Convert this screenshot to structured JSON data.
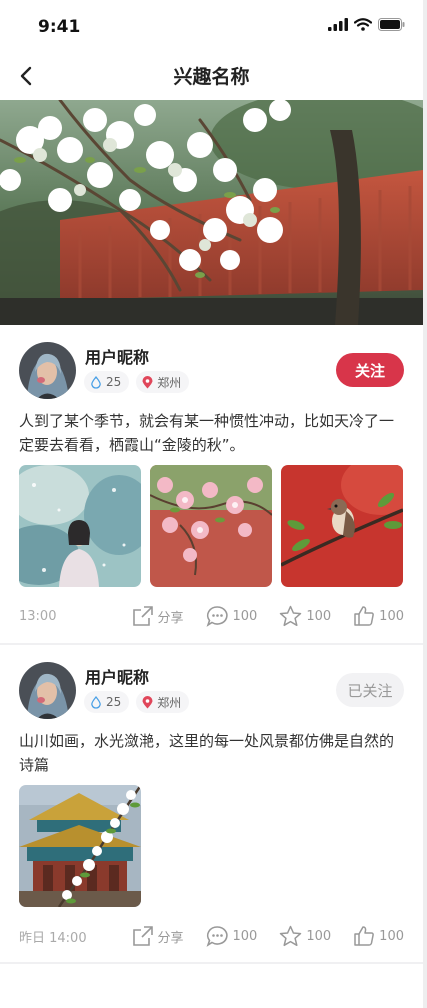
{
  "status_bar": {
    "time": "9:41"
  },
  "nav": {
    "title": "兴趣名称"
  },
  "posts": [
    {
      "nickname": "用户昵称",
      "level": "25",
      "location": "郑州",
      "follow_label": "关注",
      "text": "人到了某个季节，就会有某一种惯性冲动，比如天冷了一定要去看看，栖霞山“金陵的秋”。",
      "time": "13:00",
      "share_label": "分享",
      "comments": "100",
      "favorites": "100",
      "likes": "100"
    },
    {
      "nickname": "用户昵称",
      "level": "25",
      "location": "郑州",
      "follow_label": "已关注",
      "text": "山川如画，水光潋滟，这里的每一处风景都仿佛是自然的诗篇",
      "time": "昨日 14:00",
      "share_label": "分享",
      "comments": "100",
      "favorites": "100",
      "likes": "100"
    }
  ],
  "colors": {
    "accent": "#d8354a",
    "muted": "#999999"
  }
}
